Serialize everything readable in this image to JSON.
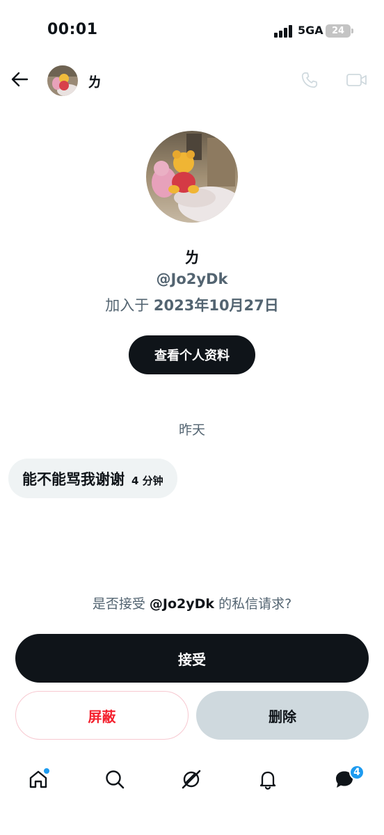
{
  "status_bar": {
    "time": "00:01",
    "network": "5GA",
    "battery": "24"
  },
  "header": {
    "name": "ㄌ"
  },
  "profile": {
    "name": "ㄌ",
    "handle": "@Jo2yDk",
    "joined_prefix": "加入于",
    "joined_date": "2023年10月27日",
    "view_profile_label": "查看个人资料"
  },
  "conversation": {
    "date_divider": "昨天",
    "messages": [
      {
        "text": "能不能骂我谢谢",
        "time": "4 分钟"
      }
    ]
  },
  "request": {
    "prompt_prefix": "是否接受",
    "prompt_handle": "@Jo2yDk",
    "prompt_suffix": "的私信请求?",
    "accept_label": "接受",
    "block_label": "屏蔽",
    "delete_label": "删除"
  },
  "bottom_nav": {
    "items": [
      {
        "icon": "home-icon",
        "has_dot": true
      },
      {
        "icon": "search-icon"
      },
      {
        "icon": "grok-icon"
      },
      {
        "icon": "bell-icon"
      },
      {
        "icon": "messages-icon",
        "badge": "4"
      }
    ]
  },
  "colors": {
    "primary_text": "#0f1419",
    "secondary_text": "#536471",
    "accent_blue": "#1d9bf0",
    "danger_red": "#f4212e",
    "bubble_bg": "#eff3f4",
    "delete_bg": "#cfd9de"
  }
}
